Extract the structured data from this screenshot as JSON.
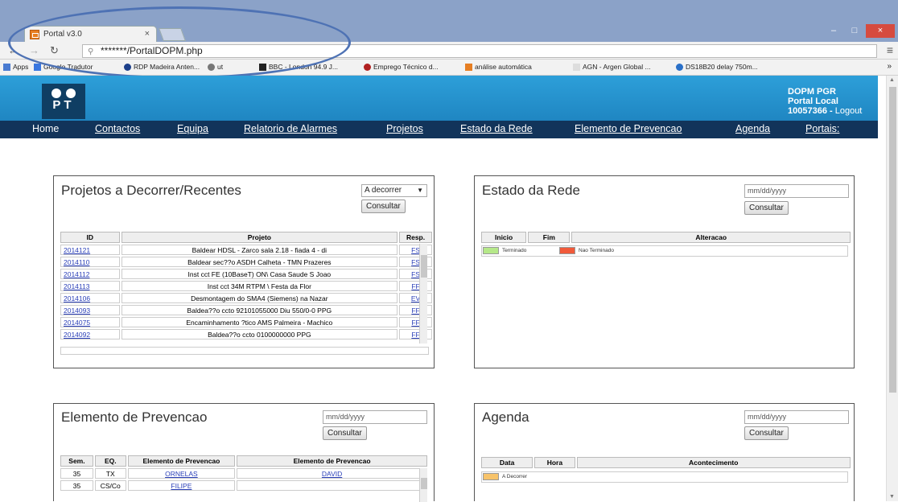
{
  "browser": {
    "tab_title": "Portal v3.0",
    "tab_close": "×",
    "url": "*******/PortalDOPM.php",
    "window_controls": {
      "minimize": "‒",
      "maximize": "□",
      "close": "×"
    },
    "bookmarks": [
      {
        "label": "Apps",
        "color": "#4a7bd1",
        "shape": "sq"
      },
      {
        "label": "Google Tradutor",
        "color": "#3a77e0",
        "shape": "sq"
      },
      {
        "label": "RDP Madeira Anten...",
        "color": "#1d3f8a",
        "shape": "dot"
      },
      {
        "label": "ut",
        "color": "#777777",
        "shape": "dot"
      },
      {
        "label": "BBC - London 94.9 J...",
        "color": "#222222",
        "shape": "sq"
      },
      {
        "label": "Emprego Técnico d...",
        "color": "#b02020",
        "shape": "dot"
      },
      {
        "label": "análise automática",
        "color": "#e67e22",
        "shape": "sq"
      },
      {
        "label": "AGN - Argen Global ...",
        "color": "#dddddd",
        "shape": "sq"
      },
      {
        "label": "DS18B20 delay 750m...",
        "color": "#2a70c8",
        "shape": "dot"
      }
    ],
    "bookmarks_more": "»"
  },
  "header": {
    "logo_text": "PT",
    "right": {
      "line1": "DOPM PGR",
      "line2": "Portal Local",
      "user": "10057366 - ",
      "logout": "Logout"
    }
  },
  "nav": {
    "items": [
      "Home",
      "Contactos",
      "Equipa",
      "Relatorio de Alarmes",
      "Projetos",
      "Estado da Rede",
      "Elemento de Prevencao",
      "Agenda",
      "Portais:"
    ]
  },
  "projetos": {
    "title": "Projetos a Decorrer/Recentes",
    "select_value": "A decorrer",
    "button": "Consultar",
    "columns": [
      "ID",
      "Projeto",
      "Resp."
    ],
    "rows": [
      {
        "id": "2014121",
        "projeto": "Baldear HDSL - Zarco sala 2.18 - fiada 4 - di",
        "resp": "FS"
      },
      {
        "id": "2014110",
        "projeto": "Baldear sec??o ASDH Calheta - TMN Prazeres",
        "resp": "FS"
      },
      {
        "id": "2014112",
        "projeto": "Inst cct FE (10BaseT) ON\\ Casa Saude S Joao",
        "resp": "FS"
      },
      {
        "id": "2014113",
        "projeto": "Inst cct 34M RTPM \\ Festa da Flor",
        "resp": "FF"
      },
      {
        "id": "2014106",
        "projeto": "Desmontagem do SMA4 (Siemens) na Nazar",
        "resp": "EV"
      },
      {
        "id": "2014093",
        "projeto": "Baldea??o ccto 92101055000 Diu 550/0-0 PPG",
        "resp": "FF"
      },
      {
        "id": "2014075",
        "projeto": "Encaminhamento ?tico AMS Palmeira - Machico",
        "resp": "FF"
      },
      {
        "id": "2014092",
        "projeto": "Baldea??o ccto 0100000000 PPG",
        "resp": "FF"
      }
    ]
  },
  "estado": {
    "title": "Estado da Rede",
    "date_placeholder": "mm/dd/yyyy",
    "button": "Consultar",
    "columns": [
      "Inicio",
      "Fim",
      "Alteracao"
    ],
    "legend": [
      {
        "label": "Terminado",
        "color": "#b5e889"
      },
      {
        "label": "Nao Terminado",
        "color": "#f15a3a"
      }
    ]
  },
  "elemento": {
    "title": "Elemento de Prevencao",
    "date_placeholder": "mm/dd/yyyy",
    "button": "Consultar",
    "columns": [
      "Sem.",
      "EQ.",
      "Elemento de Prevencao",
      "Elemento de Prevencao"
    ],
    "rows": [
      {
        "sem": "35",
        "eq": "TX",
        "el1": "ORNELAS",
        "el2": "DAVID"
      },
      {
        "sem": "35",
        "eq": "CS/Co",
        "el1": "FILIPE",
        "el2": ""
      }
    ]
  },
  "agenda": {
    "title": "Agenda",
    "date_placeholder": "mm/dd/yyyy",
    "button": "Consultar",
    "columns": [
      "Data",
      "Hora",
      "Acontecimento"
    ],
    "legend": [
      {
        "label": "A Decorrer",
        "color": "#f7c36a"
      }
    ]
  }
}
